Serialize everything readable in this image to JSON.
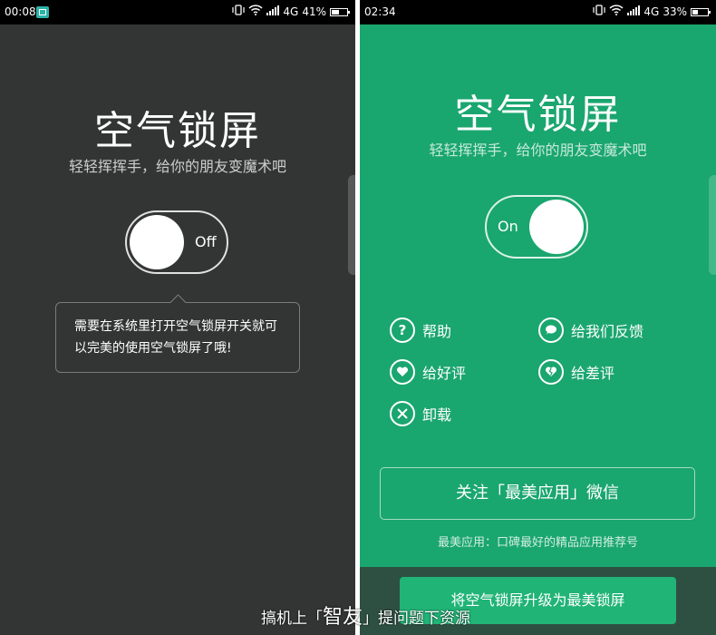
{
  "left_screen": {
    "status": {
      "time": "00:08",
      "network": "4G",
      "battery": "41%",
      "battery_level": 0.41
    },
    "title": "空气锁屏",
    "subtitle": "轻轻挥挥手，给你的朋友变魔术吧",
    "toggle": {
      "state_label": "Off",
      "on": false
    },
    "tooltip": {
      "text": "需要在系统里打开空气锁屏开关就可以完美的使用空气锁屏了哦!"
    }
  },
  "right_screen": {
    "status": {
      "time": "02:34",
      "network": "4G",
      "battery": "33%",
      "battery_level": 0.33
    },
    "title": "空气锁屏",
    "subtitle": "轻轻挥挥手，给你的朋友变魔术吧",
    "toggle": {
      "state_label": "On",
      "on": true
    },
    "actions": {
      "help": {
        "label": "帮助",
        "icon": "question-icon"
      },
      "feedback": {
        "label": "给我们反馈",
        "icon": "chat-bubble-icon"
      },
      "rate_good": {
        "label": "给好评",
        "icon": "heart-icon"
      },
      "rate_bad": {
        "label": "给差评",
        "icon": "broken-heart-icon"
      },
      "uninstall": {
        "label": "卸载",
        "icon": "tools-icon"
      }
    },
    "wechat_button": "关注「最美应用」微信",
    "caption": "最美应用：口碑最好的精品应用推荐号",
    "upgrade_button": "将空气锁屏升级为最美锁屏"
  },
  "watermark": {
    "prefix": "搞机上「",
    "brand": "智友",
    "suffix": "」提问题下资源"
  },
  "colors": {
    "left_bg": "#333534",
    "right_bg": "#1aa66f",
    "button_green": "#20b476",
    "bottom_bar": "#2e5043"
  }
}
